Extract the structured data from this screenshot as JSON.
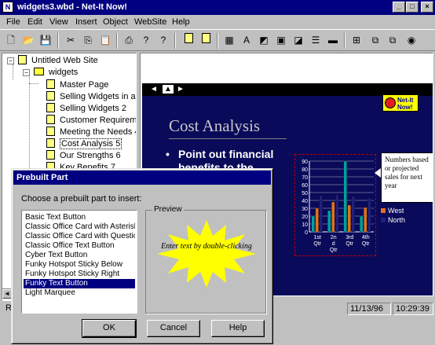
{
  "window": {
    "title": "widgets3.wbd - Net-It Now!",
    "app_icon_glyph": "N"
  },
  "menubar": {
    "items": [
      "File",
      "Edit",
      "View",
      "Insert",
      "Object",
      "WebSite",
      "Help"
    ]
  },
  "toolbar": {
    "icons": [
      "new-icon",
      "open-icon",
      "save-icon",
      "cut-icon",
      "copy-icon",
      "paste-icon",
      "print-icon",
      "help-icon",
      "context-help-icon",
      "new-page-icon",
      "insert-page-icon",
      "grid-icon",
      "text-icon",
      "image-icon",
      "picture-icon",
      "hotspot-icon",
      "list-icon",
      "marquee-icon",
      "publish-icon",
      "copy-page-icon",
      "page-setup-icon",
      "browser-icon"
    ]
  },
  "tree": {
    "root": "Untitled Web Site",
    "folder": "widgets",
    "pages": [
      "Master Page",
      "Selling Widgets in a t",
      "Selling Widgets 2",
      "Customer Requiremer",
      "Meeting the Needs 4",
      "Cost Analysis 5",
      "Our Strengths 6",
      "Key Benefits 7"
    ],
    "selected_index": 5
  },
  "slide": {
    "nav_prev": "◄",
    "nav_home": "▲",
    "nav_next": "►",
    "logo": "Net-It Now!",
    "title": "Cost Analysis",
    "bullet": "Point out financial benefits to the",
    "callout": "Numbers based or projected sales for next year",
    "legend": [
      "West",
      "North"
    ]
  },
  "chart_data": {
    "type": "bar",
    "categories": [
      "1st Qtr",
      "2nd Qtr",
      "3rd Qtr",
      "4th Qtr"
    ],
    "series": [
      {
        "name": "",
        "values": [
          20,
          27,
          90,
          20
        ]
      },
      {
        "name": "West",
        "values": [
          30,
          38,
          34,
          31
        ]
      },
      {
        "name": "North",
        "values": [
          46,
          47,
          45,
          43
        ]
      }
    ],
    "ylim": [
      0,
      90
    ],
    "yticks": [
      0,
      10,
      20,
      30,
      40,
      50,
      60,
      70,
      80,
      90
    ],
    "xtick_labels": [
      [
        "1st",
        "Qtr"
      ],
      [
        "2n",
        "d",
        "Qtr"
      ],
      [
        "3rd",
        "Qtr"
      ],
      [
        "4th",
        "Qtr"
      ]
    ],
    "colors": [
      "#00a0a0",
      "#e07020",
      "#202080"
    ]
  },
  "statusbar": {
    "left": "Re",
    "date": "11/13/96",
    "time": "10:29:39"
  },
  "dialog": {
    "title": "Prebuilt Part",
    "prompt": "Choose a prebuilt part to insert:",
    "items": [
      "Basic Text Button",
      "Classic Office Card with Asterisk",
      "Classic Office Card with Question",
      "Classic Office Text Button",
      "Cyber Text Button",
      "Funky Hotspot Sticky Below",
      "Funky Hotspot Sticky Right",
      "Funky Text Button",
      "Light Marquee"
    ],
    "selected_index": 7,
    "preview_label": "Preview",
    "preview_text": "Enter text by double-clicking",
    "ok": "OK",
    "cancel": "Cancel",
    "help": "Help"
  }
}
